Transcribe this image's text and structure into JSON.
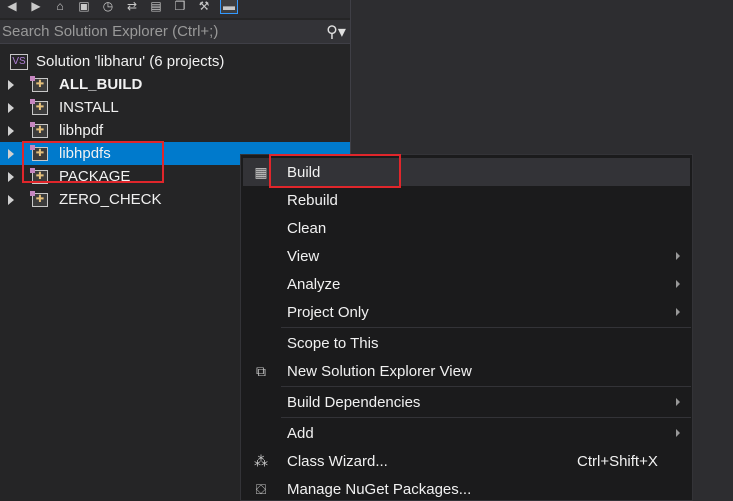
{
  "toolbar": {
    "icons": [
      "back-icon",
      "forward-icon",
      "home-icon",
      "switch-views-icon",
      "history-icon",
      "sync-icon",
      "collapse-icon",
      "copy-icon",
      "properties-icon",
      "preview-icon"
    ]
  },
  "search": {
    "placeholder": "Search Solution Explorer (Ctrl+;)",
    "icon": "search-icon"
  },
  "tree": {
    "solution_label": "Solution 'libharu' (6 projects)",
    "projects": [
      {
        "label": "ALL_BUILD",
        "bold": true
      },
      {
        "label": "INSTALL"
      },
      {
        "label": "libhpdf"
      },
      {
        "label": "libhpdfs",
        "selected": true
      },
      {
        "label": "PACKAGE"
      },
      {
        "label": "ZERO_CHECK"
      }
    ]
  },
  "menu": {
    "items": [
      {
        "label": "Build",
        "icon": "build-icon",
        "highlighted": true
      },
      {
        "label": "Rebuild"
      },
      {
        "label": "Clean"
      },
      {
        "label": "View",
        "submenu": true
      },
      {
        "label": "Analyze",
        "submenu": true
      },
      {
        "label": "Project Only",
        "submenu": true
      },
      {
        "label": "Scope to This"
      },
      {
        "label": "New Solution Explorer View",
        "icon": "new-view-icon"
      },
      {
        "label": "Build Dependencies",
        "submenu": true
      },
      {
        "label": "Add",
        "submenu": true
      },
      {
        "label": "Class Wizard...",
        "icon": "class-wizard-icon",
        "shortcut": "Ctrl+Shift+X"
      },
      {
        "label": "Manage NuGet Packages...",
        "icon": "nuget-icon"
      }
    ]
  },
  "colors": {
    "selection": "#007acc",
    "highlight_box": "#e0262b",
    "menu_bg": "#1b1b1c",
    "panel_bg": "#252526"
  }
}
